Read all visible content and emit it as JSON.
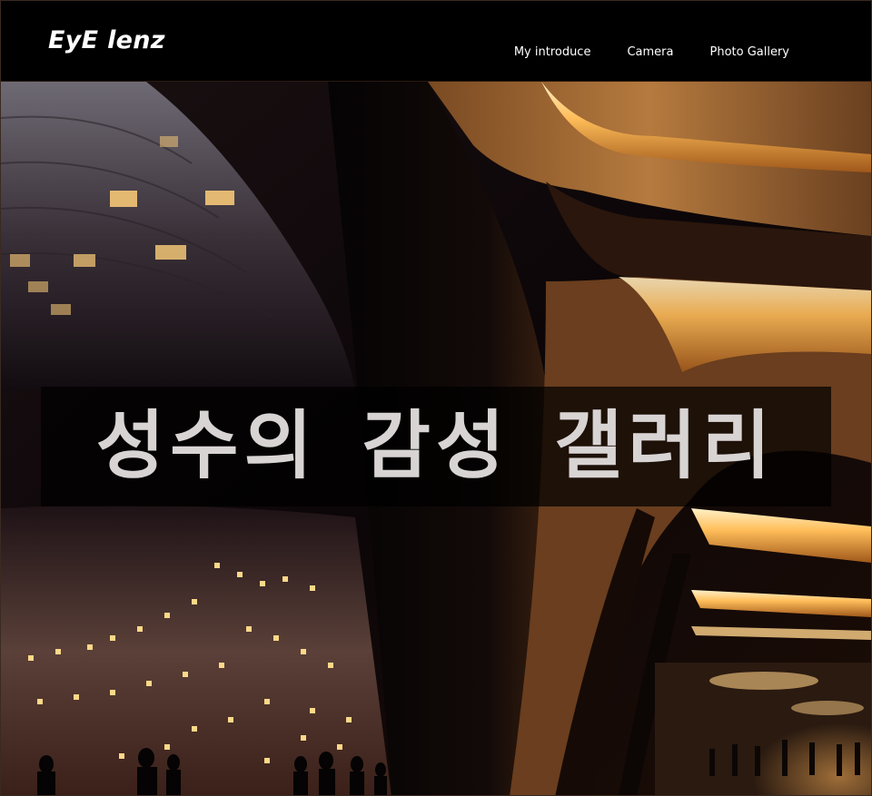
{
  "header": {
    "brand": "EyE lenz",
    "nav": [
      {
        "label": "My introduce"
      },
      {
        "label": "Camera"
      },
      {
        "label": "Photo Gallery"
      }
    ]
  },
  "hero": {
    "title": "성수의 감성 갤러리",
    "image": "night-architecture-photo"
  },
  "colors": {
    "navbar_bg": "#000000",
    "nav_text": "#ffffff",
    "title_text": "#d9d4d4",
    "title_box": "rgba(0,0,0,0.72)",
    "light_glow": "#ffb347"
  }
}
